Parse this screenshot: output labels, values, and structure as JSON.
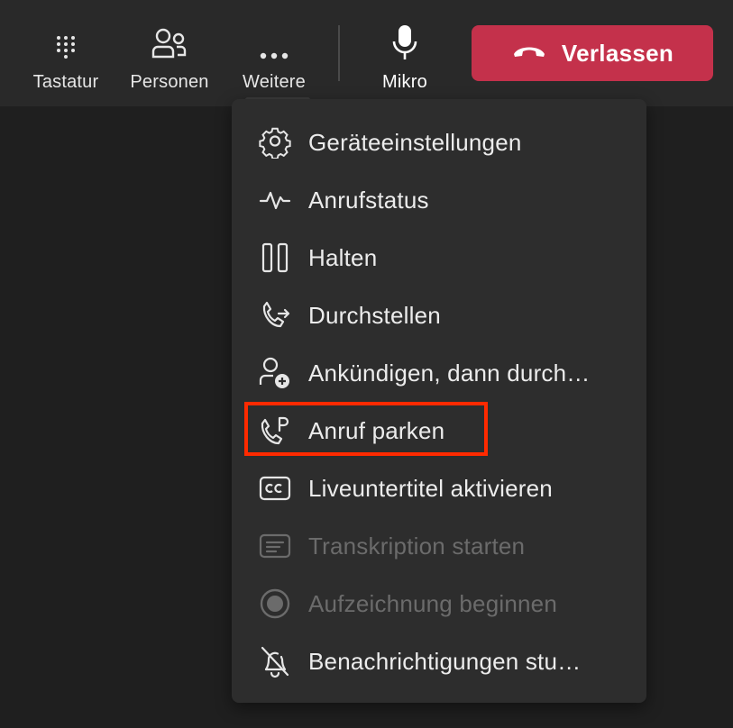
{
  "toolbar": {
    "keypad_label": "Tastatur",
    "people_label": "Personen",
    "more_label": "Weitere",
    "mic_label": "Mikro",
    "leave_label": "Verlassen",
    "leave_color": "#c4314b"
  },
  "menu": {
    "items": [
      {
        "label": "Geräteeinstellungen",
        "icon": "gear-icon",
        "enabled": true
      },
      {
        "label": "Anrufstatus",
        "icon": "pulse-icon",
        "enabled": true
      },
      {
        "label": "Halten",
        "icon": "pause-icon",
        "enabled": true
      },
      {
        "label": "Durchstellen",
        "icon": "call-transfer-icon",
        "enabled": true
      },
      {
        "label": "Ankündigen, dann durch…",
        "icon": "person-add-icon",
        "enabled": true
      },
      {
        "label": "Anruf parken",
        "icon": "call-park-icon",
        "enabled": true,
        "highlighted": true
      },
      {
        "label": "Liveuntertitel aktivieren",
        "icon": "closed-captions-icon",
        "enabled": true
      },
      {
        "label": "Transkription starten",
        "icon": "transcript-icon",
        "enabled": false
      },
      {
        "label": "Aufzeichnung beginnen",
        "icon": "record-icon",
        "enabled": false
      },
      {
        "label": "Benachrichtigungen stu…",
        "icon": "bell-off-icon",
        "enabled": true
      }
    ]
  },
  "highlight_color": "#ff2a00"
}
